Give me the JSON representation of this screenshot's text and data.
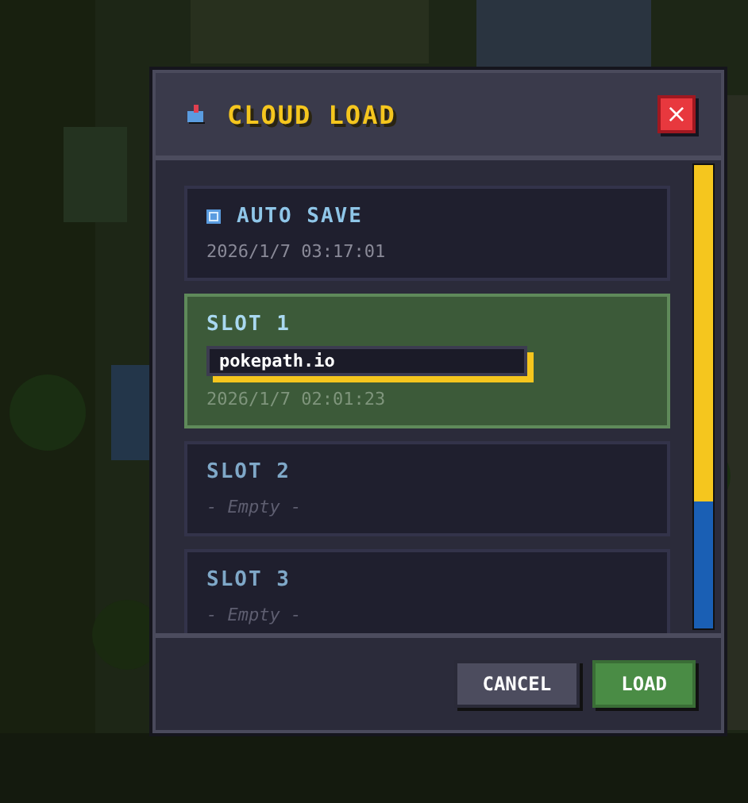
{
  "dialog": {
    "title": "CLOUD LOAD",
    "close": "×"
  },
  "slots": [
    {
      "kind": "auto",
      "name": "AUTO SAVE",
      "date": "2026/1/7 03:17:01",
      "selected": false
    },
    {
      "kind": "slot",
      "name": "SLOT 1",
      "label": "pokepath.io",
      "date": "2026/1/7 02:01:23",
      "selected": true
    },
    {
      "kind": "slot",
      "name": "SLOT 2",
      "empty": "- Empty -",
      "selected": false
    },
    {
      "kind": "slot",
      "name": "SLOT 3",
      "empty": "- Empty -",
      "selected": false
    }
  ],
  "buttons": [
    {
      "kind": "secondary",
      "label": "CANCEL"
    },
    {
      "kind": "primary",
      "label": "LOAD"
    }
  ]
}
